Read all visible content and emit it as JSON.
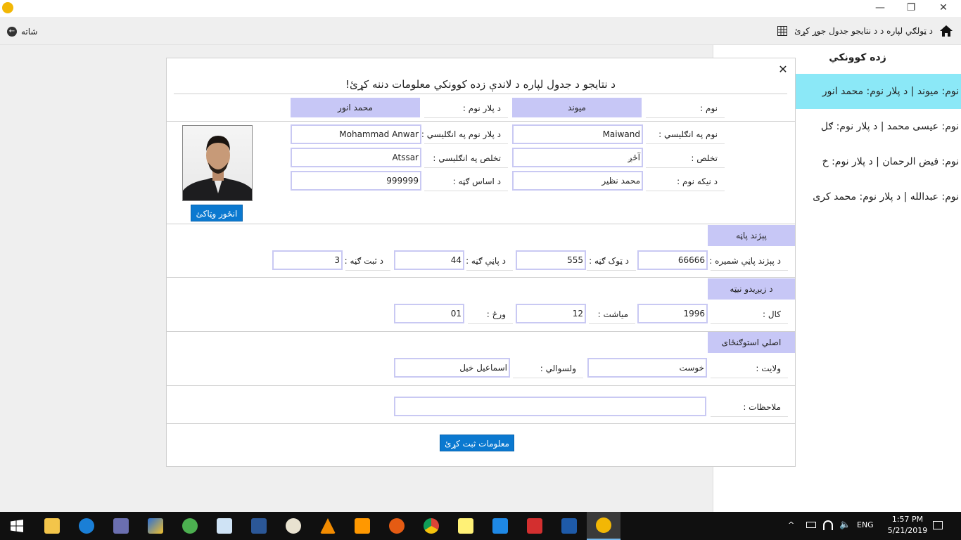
{
  "window": {
    "minimize": "—",
    "maximize": "❐",
    "close": "✕"
  },
  "nav": {
    "back_label": "شاته",
    "breadcrumb": "د ټولګي لپاره د د نتایجو جدول جوړ کړئ"
  },
  "students_panel": {
    "title": "زده کوونکي",
    "items": [
      {
        "text": "نوم: میوند  |  د پلار نوم: محمد انور",
        "selected": true
      },
      {
        "text": "نوم: عیسی محمد  |  د پلار نوم: ګل",
        "selected": false
      },
      {
        "text": "نوم: فیض الرحمان  |  د پلار نوم: خ",
        "selected": false
      },
      {
        "text": "نوم: عبدالله  |  د پلار نوم: محمد کری",
        "selected": false
      }
    ]
  },
  "dialog": {
    "title": "د نتایجو د جدول لپاره د لاندې زده کوونکي معلومات دننه کړئ!",
    "close": "✕",
    "name_label": "نوم :",
    "name_value": "میوند",
    "father_label": "د پلار نوم :",
    "father_value": "محمد انور",
    "name_en_label": "نوم په انګلیسي :",
    "name_en_value": "Maiwand",
    "father_en_label": "د پلار نوم په انګلیسي :",
    "father_en_value": "Mohammad Anwar",
    "alias_label": "تخلص :",
    "alias_value": "آځږ",
    "alias_en_label": "تخلص په انګلیسي :",
    "alias_en_value": "Atssar",
    "grandfather_label": "د نیکه نوم :",
    "grandfather_value": "محمد نظیر",
    "base_no_label": "د اساس ګڼه :",
    "base_no_value": "999999",
    "photo_button": "انځور وټاکئ",
    "tazkira": {
      "section": "پېژند پاڼه",
      "page_no_label": "د پېژند پاڼې شمیره :",
      "page_no_value": "66666",
      "volume_label": "د ټوک ګڼه :",
      "volume_value": "555",
      "page_label": "د پاڼې ګڼه :",
      "page_value": "44",
      "reg_label": "د ثبت ګڼه :",
      "reg_value": "3"
    },
    "birth": {
      "section": "د زیږیدو نیټه",
      "year_label": "کال :",
      "year_value": "1996",
      "month_label": "میاشت :",
      "month_value": "12",
      "day_label": "ورځ :",
      "day_value": "01"
    },
    "residence": {
      "section": "اصلي استوګنځای",
      "province_label": "ولایت :",
      "province_value": "خوست",
      "district_label": "ولسوالي :",
      "district_value": "اسماعیل خیل"
    },
    "notes_label": "ملاحظات :",
    "notes_value": "",
    "submit": "معلومات ثبت کړئ"
  },
  "taskbar": {
    "apps": [
      "start-icon",
      "file-explorer-icon",
      "edge-icon",
      "tower-icon",
      "app-icon",
      "visual-basic-icon",
      "notepad-icon",
      "word-icon",
      "paint-icon",
      "vlc-icon",
      "sublime-icon",
      "firefox-icon",
      "chrome-icon",
      "sticky-notes-icon",
      "vscode-icon",
      "acrobat-icon",
      "powershell-icon",
      "active-app-icon"
    ],
    "lang": "ENG",
    "time": "1:57 PM",
    "date": "5/21/2019"
  },
  "colors": {
    "accent": "#0b79d0",
    "selected_row": "#8be8f7",
    "section_bg": "#c7c7f6",
    "field_border": "#c9c9f3"
  }
}
